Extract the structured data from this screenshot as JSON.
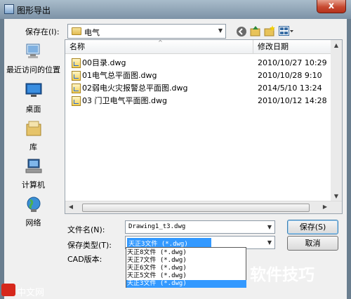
{
  "window": {
    "title": "图形导出",
    "close": "x"
  },
  "toolbar": {
    "save_in_label": "保存在(I):",
    "save_in_value": "电气",
    "icons": [
      "back-icon",
      "up-folder-icon",
      "new-folder-icon",
      "view-menu-icon"
    ]
  },
  "places": [
    {
      "label": "最近访问的位置",
      "icon": "recent-places-icon"
    },
    {
      "label": "桌面",
      "icon": "desktop-icon"
    },
    {
      "label": "库",
      "icon": "libraries-icon"
    },
    {
      "label": "计算机",
      "icon": "computer-icon"
    },
    {
      "label": "网络",
      "icon": "network-icon"
    }
  ],
  "file_list": {
    "columns": [
      "名称",
      "修改日期"
    ],
    "rows": [
      {
        "name": "00目录.dwg",
        "date": "2010/10/27 10:29"
      },
      {
        "name": "01电气总平面图.dwg",
        "date": "2010/10/28 9:10"
      },
      {
        "name": "02弱电火灾报警总平面图.dwg",
        "date": "2014/5/10 13:24"
      },
      {
        "name": "03 门卫电气平面图.dwg",
        "date": "2010/10/12 14:28"
      }
    ]
  },
  "form": {
    "filename_label": "文件名(N):",
    "filename_value": "Drawing1_t3.dwg",
    "filetype_label": "保存类型(T):",
    "filetype_value": "天正3文件 (*.dwg)",
    "cad_version_label": "CAD版本:",
    "save_button": "保存(S)",
    "cancel_button": "取消"
  },
  "filetype_options": [
    {
      "label": "天正8文件 (*.dwg)",
      "selected": false
    },
    {
      "label": "天正7文件 (*.dwg)",
      "selected": false
    },
    {
      "label": "天正6文件 (*.dwg)",
      "selected": false
    },
    {
      "label": "天正5文件 (*.dwg)",
      "selected": false
    },
    {
      "label": "天正3文件 (*.dwg)",
      "selected": true
    }
  ],
  "watermarks": {
    "right": "软件技巧",
    "left": "中文网"
  },
  "colors": {
    "selection": "#3399ff",
    "close_button": "#c74a31",
    "titlebar": "#8fa4b7"
  }
}
